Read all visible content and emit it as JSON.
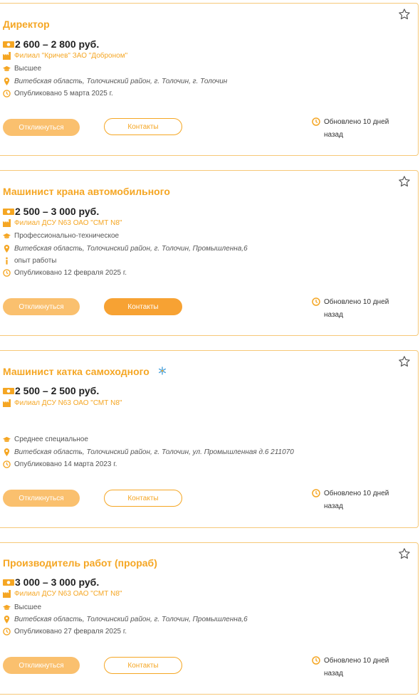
{
  "colors": {
    "accent": "#f5a623",
    "accent_light": "#fac06e",
    "border": "#f6c878"
  },
  "jobs": [
    {
      "title": "Директор",
      "salary": "2 600 – 2 800 руб.",
      "employer": "Филиал \"Кричев\" ЗАО \"Доброном\"",
      "education": "Высшее",
      "address": "Витебская область, Толочинский район, г. Толочин, г. Толочин",
      "published": "Опубликовано 5 марта 2025 г.",
      "respond_label": "Откликнуться",
      "contacts_label": "Контакты",
      "updated_line1": "Обновлено 10 дней",
      "updated_line2": "назад"
    },
    {
      "title": "Машинист крана автомобильного",
      "salary": "2 500 – 3 000 руб.",
      "employer": "Филиал ДСУ N63 ОАО \"СМТ N8\"",
      "education": "Профессионально-техническое",
      "address": "Витебская область, Толочинский район, г. Толочин, Промышленна,6",
      "experience": "опыт работы",
      "published": "Опубликовано 12 февраля 2025 г.",
      "respond_label": "Откликнуться",
      "contacts_label": "Контакты",
      "updated_line1": "Обновлено 10 дней",
      "updated_line2": "назад"
    },
    {
      "title": "Машинист катка самоходного",
      "salary": "2 500 – 2 500 руб.",
      "employer": "Филиал ДСУ N63 ОАО \"СМТ N8\"",
      "education": "Среднее специальное",
      "address": "Витебская область, Толочинский район, г. Толочин, ул. Промышленная д.6 211070",
      "published": "Опубликовано 14 марта 2023 г.",
      "respond_label": "Откликнуться",
      "contacts_label": "Контакты",
      "updated_line1": "Обновлено 10 дней",
      "updated_line2": "назад"
    },
    {
      "title": "Производитель работ (прораб)",
      "salary": "3 000 – 3 000 руб.",
      "employer": "Филиал ДСУ N63 ОАО \"СМТ N8\"",
      "education": "Высшее",
      "address": "Витебская область, Толочинский район, г. Толочин, Промышленна,6",
      "published": "Опубликовано 27 февраля 2025 г.",
      "respond_label": "Откликнуться",
      "contacts_label": "Контакты",
      "updated_line1": "Обновлено 10 дней",
      "updated_line2": "назад"
    }
  ]
}
